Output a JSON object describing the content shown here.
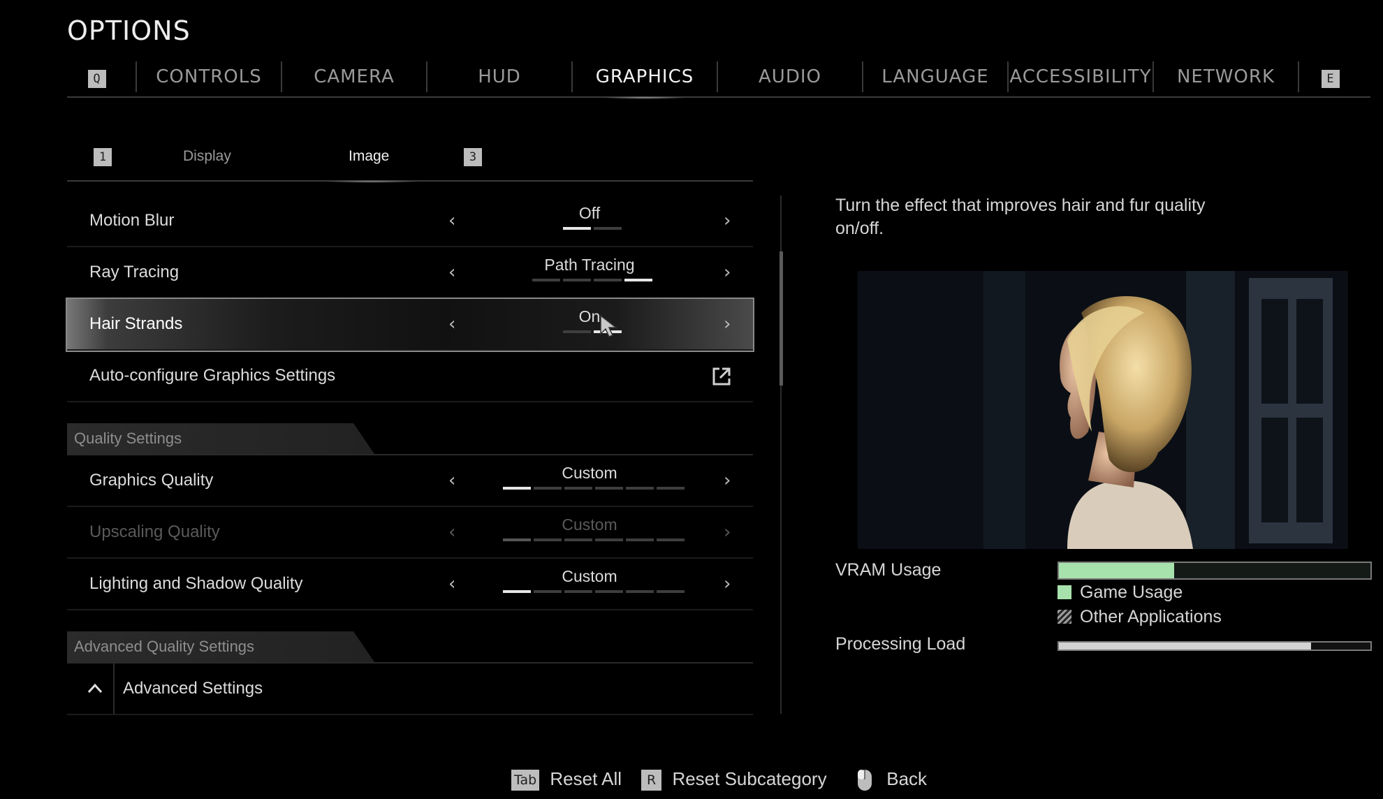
{
  "header": {
    "title": "OPTIONS"
  },
  "tabs": {
    "prev_key": "Q",
    "next_key": "E",
    "items": [
      {
        "label": "CONTROLS"
      },
      {
        "label": "CAMERA"
      },
      {
        "label": "HUD"
      },
      {
        "label": "GRAPHICS",
        "active": true
      },
      {
        "label": "AUDIO"
      },
      {
        "label": "LANGUAGE"
      },
      {
        "label": "ACCESSIBILITY"
      },
      {
        "label": "NETWORK"
      }
    ]
  },
  "subtabs": {
    "prev_key": "1",
    "next_key": "3",
    "items": [
      {
        "label": "Display"
      },
      {
        "label": "Image",
        "active": true
      }
    ]
  },
  "settings": {
    "motion_blur": {
      "label": "Motion Blur",
      "value": "Off",
      "level": 1,
      "steps": 2
    },
    "ray_tracing": {
      "label": "Ray Tracing",
      "value": "Path Tracing",
      "level": 4,
      "steps": 4
    },
    "hair_strands": {
      "label": "Hair Strands",
      "value": "On",
      "level": 2,
      "steps": 2
    },
    "auto_config": {
      "label": "Auto-configure Graphics Settings",
      "icon": "external-link-icon"
    },
    "quality_section": "Quality Settings",
    "graphics_quality": {
      "label": "Graphics Quality",
      "value": "Custom",
      "level": 1,
      "steps": 6
    },
    "upscaling_quality": {
      "label": "Upscaling Quality",
      "value": "Custom",
      "level": 1,
      "steps": 6,
      "disabled": true
    },
    "lighting_quality": {
      "label": "Lighting and Shadow Quality",
      "value": "Custom",
      "level": 1,
      "steps": 6
    },
    "advanced_section": "Advanced Quality Settings",
    "advanced": {
      "label": "Advanced Settings",
      "icon": "chevron-up-icon"
    }
  },
  "info": {
    "description": "Turn the effect that improves hair and fur quality on/off.",
    "vram_label": "VRAM Usage",
    "vram_game_fraction": 0.37,
    "legend_game": "Game Usage",
    "legend_other": "Other Applications",
    "processing_label": "Processing Load",
    "processing_fraction": 0.81,
    "colors": {
      "game": "#a7e2ad",
      "other": "#9a9a9a"
    }
  },
  "footer": {
    "reset_all_key": "Tab",
    "reset_all": "Reset All",
    "reset_sub_key": "R",
    "reset_sub": "Reset Subcategory",
    "back_icon": "mouse-icon",
    "back": "Back"
  }
}
